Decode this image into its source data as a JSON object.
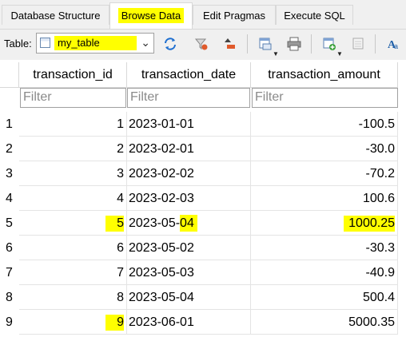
{
  "tabs": [
    {
      "label": "Database Structure",
      "active": false
    },
    {
      "label": "Browse Data",
      "active": true
    },
    {
      "label": "Edit Pragmas",
      "active": false
    },
    {
      "label": "Execute SQL",
      "active": false
    }
  ],
  "toolbar": {
    "table_label": "Table:",
    "selected_table": "my_table",
    "icons": [
      "refresh-icon",
      "clear-filters-icon",
      "delete-sort-icon",
      "save-table-icon",
      "print-icon",
      "insert-record-icon",
      "delete-record-icon",
      "text-format-icon"
    ]
  },
  "grid": {
    "columns": [
      "transaction_id",
      "transaction_date",
      "transaction_amount"
    ],
    "filter_placeholder": "Filter",
    "rows": [
      {
        "num": "1",
        "id": "1",
        "date": "2023-01-01",
        "amount": "-100.5"
      },
      {
        "num": "2",
        "id": "2",
        "date": "2023-02-01",
        "amount": "-30.0"
      },
      {
        "num": "3",
        "id": "3",
        "date": "2023-02-02",
        "amount": "-70.2"
      },
      {
        "num": "4",
        "id": "4",
        "date": "2023-02-03",
        "amount": "100.6"
      },
      {
        "num": "5",
        "id": "5",
        "date": "2023-05-04",
        "amount": "1000.25"
      },
      {
        "num": "6",
        "id": "6",
        "date": "2023-05-02",
        "amount": "-30.3"
      },
      {
        "num": "7",
        "id": "7",
        "date": "2023-05-03",
        "amount": "-40.9"
      },
      {
        "num": "8",
        "id": "8",
        "date": "2023-05-04",
        "amount": "500.4"
      },
      {
        "num": "9",
        "id": "9",
        "date": "2023-06-01",
        "amount": "5000.35"
      }
    ]
  },
  "colors": {
    "highlight": "#ffff00",
    "grid_line": "#e4e4e4",
    "chrome": "#f0f0f0"
  }
}
